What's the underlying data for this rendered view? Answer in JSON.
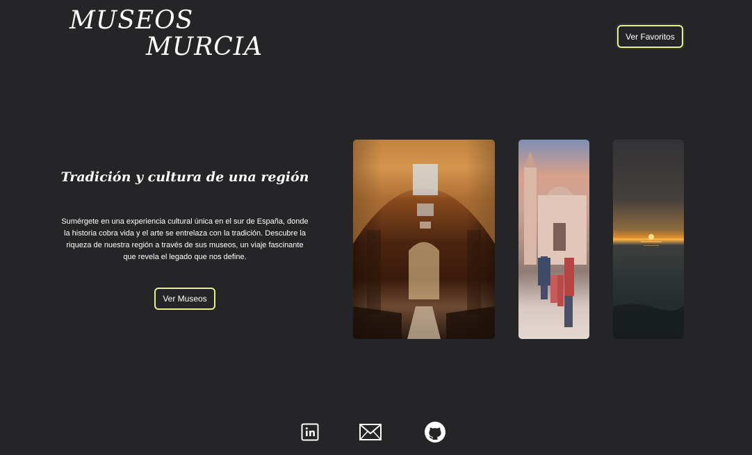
{
  "header": {
    "logo_line1": "MUSEOS",
    "logo_line2": "MURCIA",
    "favorites_label": "Ver Favoritos"
  },
  "hero": {
    "title": "Tradición y cultura de una región",
    "description": "Sumérgete en una experiencia cultural única en el sur de España, donde la historia cobra vida y el arte se entrelaza con la tradición. Descubre la riqueza de nuestra región a través de sus museos, un viaje fascinante que revela el legado que nos define.",
    "museums_label": "Ver Museos"
  },
  "gallery": {
    "images": [
      {
        "icon": "museum-interior-image"
      },
      {
        "icon": "cathedral-family-image"
      },
      {
        "icon": "sunset-sea-image"
      }
    ]
  },
  "footer": {
    "icons": [
      "linkedin-icon",
      "mail-icon",
      "github-icon"
    ]
  },
  "colors": {
    "background": "#252527",
    "button_border": "#e8f08e",
    "text": "#ffffff"
  }
}
